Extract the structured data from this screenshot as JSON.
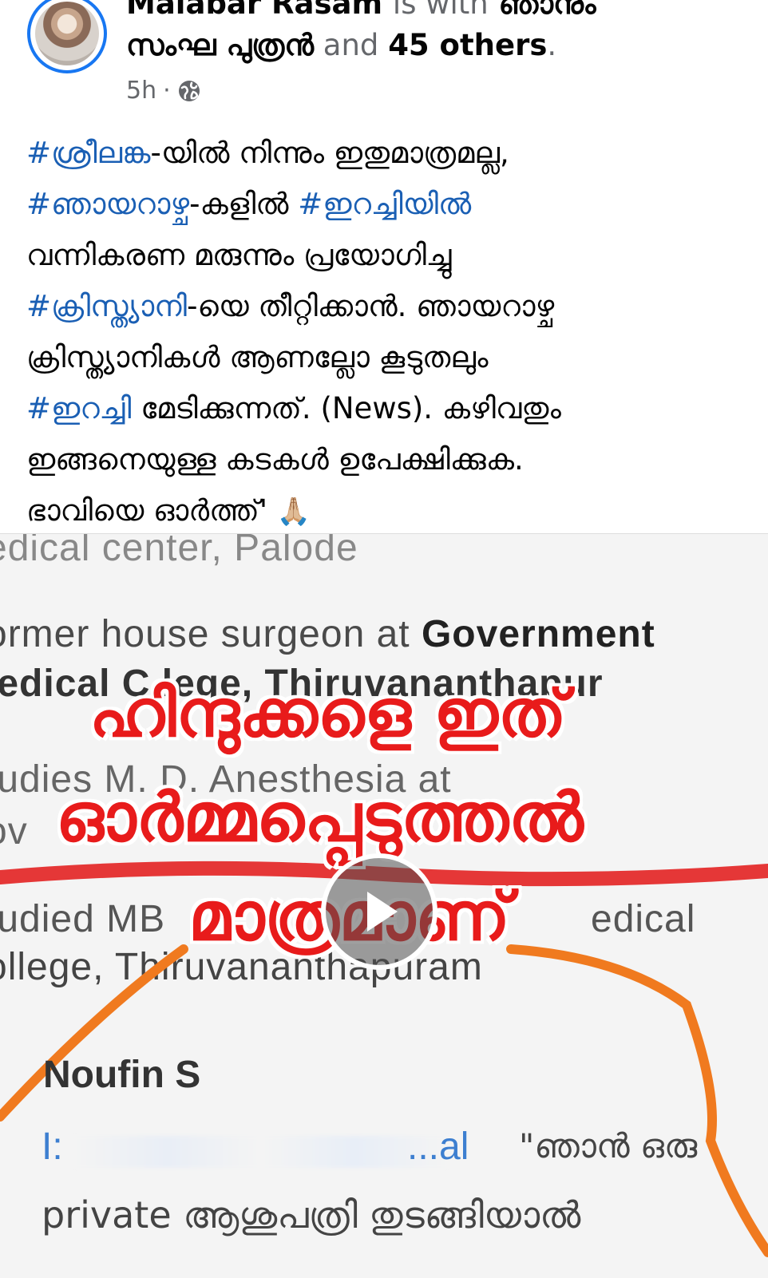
{
  "post": {
    "author": "Malabar Rasam",
    "is_with": "is with",
    "tagged_first": "ഞാനും",
    "tagged_second": "സംഘ പുത്രൻ",
    "and_word": "and",
    "others": "45 others",
    "period": ".",
    "time": "5h",
    "separator": "·",
    "privacy_icon": "globe-icon",
    "text": {
      "l1_tag": "#ശ്രീലങ്ക",
      "l1_rest": "-യിൽ നിന്നും ഇതുമാത്രമല്ല,",
      "l2_tag1": "#ഞായറാഴ്ച",
      "l2_mid": "-കളിൽ ",
      "l2_tag2": "#ഇറച്ചിയിൽ",
      "l3": "വന്നികരണ മരുന്നും പ്രയോഗിച്ചു",
      "l4_tag": "#ക്രിസ്ത്യാനി",
      "l4_rest": "-യെ തീറ്റിക്കാൻ. ഞായറാഴ്ച",
      "l5": "ക്രിസ്ത്യാനികൾ ആണല്ലോ കൂടുതലും",
      "l6_tag": "#ഇറച്ചി",
      "l6_rest": " മേടിക്കുന്നത്. (News). കഴിവതും",
      "l7": "ഇങ്ങനെയുള്ള കടകൾ ഉപേക്ഷിക്കുക.",
      "l8": "ഭാവിയെ ഓർത്ത്' ",
      "emoji": "🙏🏼"
    }
  },
  "media": {
    "screenshot_lines": {
      "l1": "edical center, Palode",
      "l2_a": "ormer house surgeon at ",
      "l2_b": "Government",
      "l3": "ledical C  lege, Thiruvananthapur",
      "l4": "tudies M. D. Anesthesia at",
      "l5": "ov",
      "l6": "tudied MB",
      "l6_end": "edical",
      "l7": "ollege, Thiruvananthapuram",
      "name": "Noufin S",
      "link_start": "I:",
      "link_end": "...al",
      "quote": "\"ഞാൻ ഒരു",
      "private": "private ആശുപത്രി തുടങ്ങിയാൽ"
    },
    "overlay": {
      "line1": "ഹിന്ദുക്കളെ ഇത്",
      "line2": "ഓർമ്മപ്പെടുത്തൽ",
      "line3": "മാത്രമാണ്"
    },
    "play_icon": "play-icon",
    "colors": {
      "overlay_red": "#e81b1b",
      "annotation_orange": "#f07a1f",
      "hashtag_blue": "#1a5fb4",
      "avatar_ring": "#1877f2"
    }
  }
}
